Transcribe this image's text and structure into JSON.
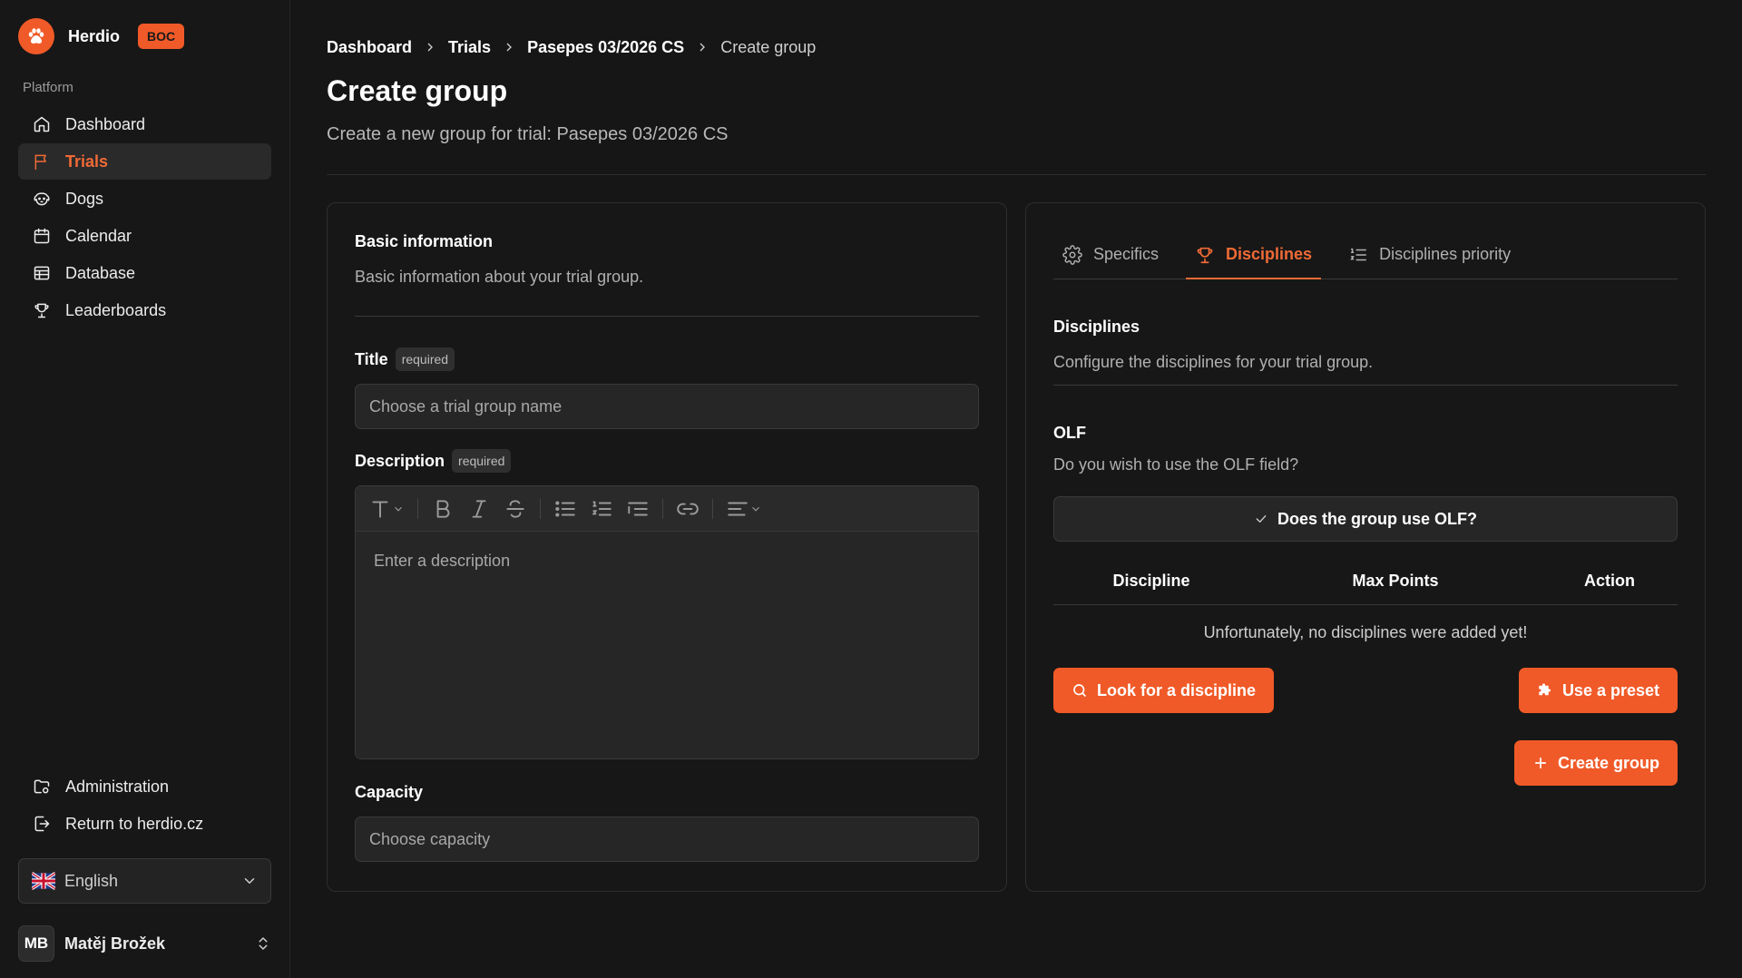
{
  "brand": {
    "name": "Herdio",
    "badge": "BOC"
  },
  "sidebar": {
    "section_label": "Platform",
    "items": [
      {
        "label": "Dashboard",
        "icon": "home-icon"
      },
      {
        "label": "Trials",
        "icon": "flag-icon",
        "active": true
      },
      {
        "label": "Dogs",
        "icon": "dog-icon"
      },
      {
        "label": "Calendar",
        "icon": "calendar-icon"
      },
      {
        "label": "Database",
        "icon": "table-icon"
      },
      {
        "label": "Leaderboards",
        "icon": "trophy-icon"
      }
    ],
    "bottom_items": [
      {
        "label": "Administration",
        "icon": "admin-icon"
      },
      {
        "label": "Return to herdio.cz",
        "icon": "exit-icon"
      }
    ],
    "language": "English",
    "user": {
      "initials": "MB",
      "name": "Matěj Brožek"
    }
  },
  "breadcrumb": [
    "Dashboard",
    "Trials",
    "Pasepes 03/2026 CS",
    "Create group"
  ],
  "page": {
    "title": "Create group",
    "subtitle": "Create a new group for trial: Pasepes 03/2026 CS"
  },
  "basic": {
    "title": "Basic information",
    "desc": "Basic information about your trial group.",
    "title_label": "Title",
    "required": "required",
    "title_placeholder": "Choose a trial group name",
    "description_label": "Description",
    "description_placeholder": "Enter a description",
    "capacity_label": "Capacity",
    "capacity_placeholder": "Choose capacity"
  },
  "tabs": [
    {
      "label": "Specifics",
      "icon": "gear-icon"
    },
    {
      "label": "Disciplines",
      "icon": "trophy-icon",
      "active": true
    },
    {
      "label": "Disciplines priority",
      "icon": "list-ordered-icon"
    }
  ],
  "disciplines": {
    "title": "Disciplines",
    "desc": "Configure the disciplines for your trial group.",
    "olf_title": "OLF",
    "olf_desc": "Do you wish to use the OLF field?",
    "olf_button": "Does the group use OLF?",
    "columns": [
      "Discipline",
      "Max Points",
      "Action"
    ],
    "empty": "Unfortunately, no disciplines were added yet!",
    "look_button": "Look for a discipline",
    "preset_button": "Use a preset",
    "create_button": "Create group"
  },
  "colors": {
    "accent": "#f05a28",
    "background": "#161616"
  }
}
